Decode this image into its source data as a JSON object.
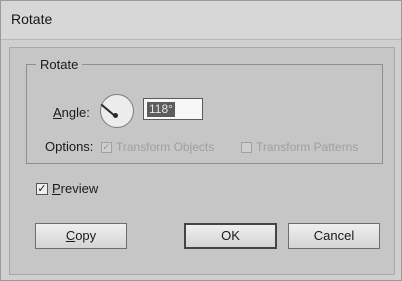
{
  "dialog": {
    "title": "Rotate"
  },
  "rotate_group": {
    "legend": "Rotate",
    "angle_label": "Angle:",
    "angle_value": "118°",
    "options_label": "Options:",
    "transform_objects_label": "Transform Objects",
    "transform_objects_checked": true,
    "transform_patterns_label": "Transform Patterns",
    "transform_patterns_checked": false
  },
  "preview": {
    "label": "Preview",
    "checked": true
  },
  "buttons": {
    "copy": "Copy",
    "ok": "OK",
    "cancel": "Cancel"
  }
}
